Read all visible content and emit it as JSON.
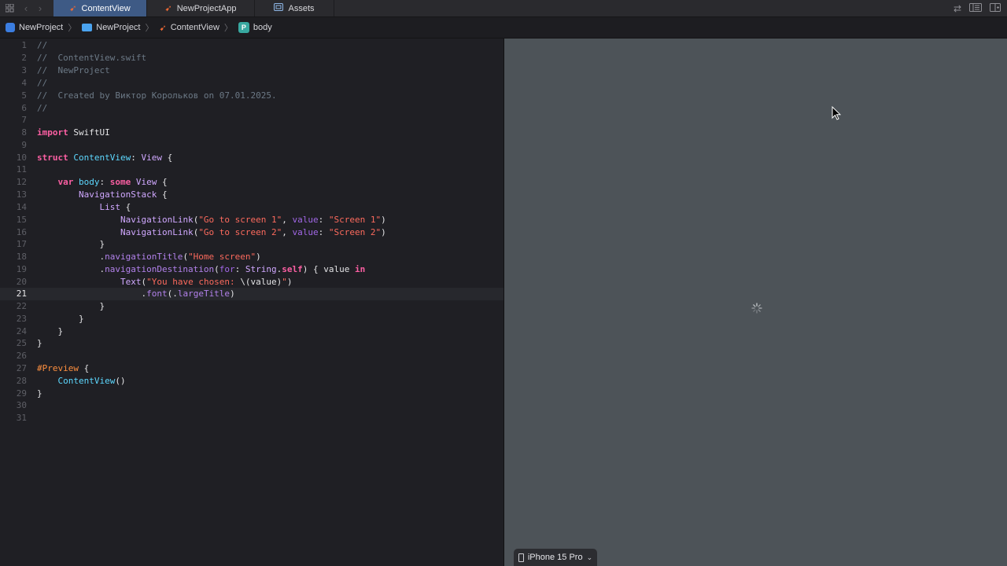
{
  "tabs": [
    {
      "label": "ContentView",
      "active": true
    },
    {
      "label": "NewProjectApp",
      "active": false
    },
    {
      "label": "Assets",
      "active": false
    }
  ],
  "breadcrumb": [
    "NewProject",
    "NewProject",
    "ContentView",
    "body"
  ],
  "breadcrumb_symbol_badge": "P",
  "editor": {
    "current_line": "21",
    "line_numbers": [
      "1",
      "2",
      "3",
      "4",
      "5",
      "6",
      "7",
      "8",
      "9",
      "10",
      "11",
      "12",
      "13",
      "14",
      "15",
      "16",
      "17",
      "18",
      "19",
      "20",
      "21",
      "22",
      "23",
      "24",
      "25",
      "26",
      "27",
      "28",
      "29",
      "30",
      "31"
    ],
    "comments": {
      "l1": "//",
      "l2": "//  ContentView.swift",
      "l3": "//  NewProject",
      "l4": "//",
      "l5": "//  Created by Виктор Корольков on 07.01.2025.",
      "l6": "//"
    },
    "tokens": {
      "import": "import",
      "swiftui": "SwiftUI",
      "struct": "struct",
      "contentview": "ContentView",
      "view": "View",
      "var": "var",
      "body": "body",
      "some": "some",
      "navstack": "NavigationStack",
      "list": "List",
      "navlink": "NavigationLink",
      "str_go1": "\"Go to screen 1\"",
      "str_go2": "\"Go to screen 2\"",
      "value_label": "value",
      "str_s1": "\"Screen 1\"",
      "str_s2": "\"Screen 2\"",
      "navtitle": "navigationTitle",
      "str_home": "\"Home screen\"",
      "navdest": "navigationDestination",
      "for_label": "for",
      "string_type": "String",
      "self_kw": "self",
      "value_param": "value",
      "in_kw": "in",
      "text": "Text",
      "str_chosen_a": "\"You have chosen: ",
      "interp": "\\(value)",
      "str_chosen_b": "\"",
      "font": "font",
      "largetitle": "largeTitle",
      "preview": "#Preview",
      "contentview_call": "ContentView"
    }
  },
  "preview": {
    "device_label": "iPhone 15 Pro"
  },
  "colors": {
    "active_tab": "#3e5a85",
    "canvas_bg": "#4d5358",
    "editor_bg": "#1f1f24",
    "keyword": "#fc5fa3",
    "string": "#fc6a5d",
    "type": "#5dd8ff",
    "comment": "#6c7986"
  }
}
